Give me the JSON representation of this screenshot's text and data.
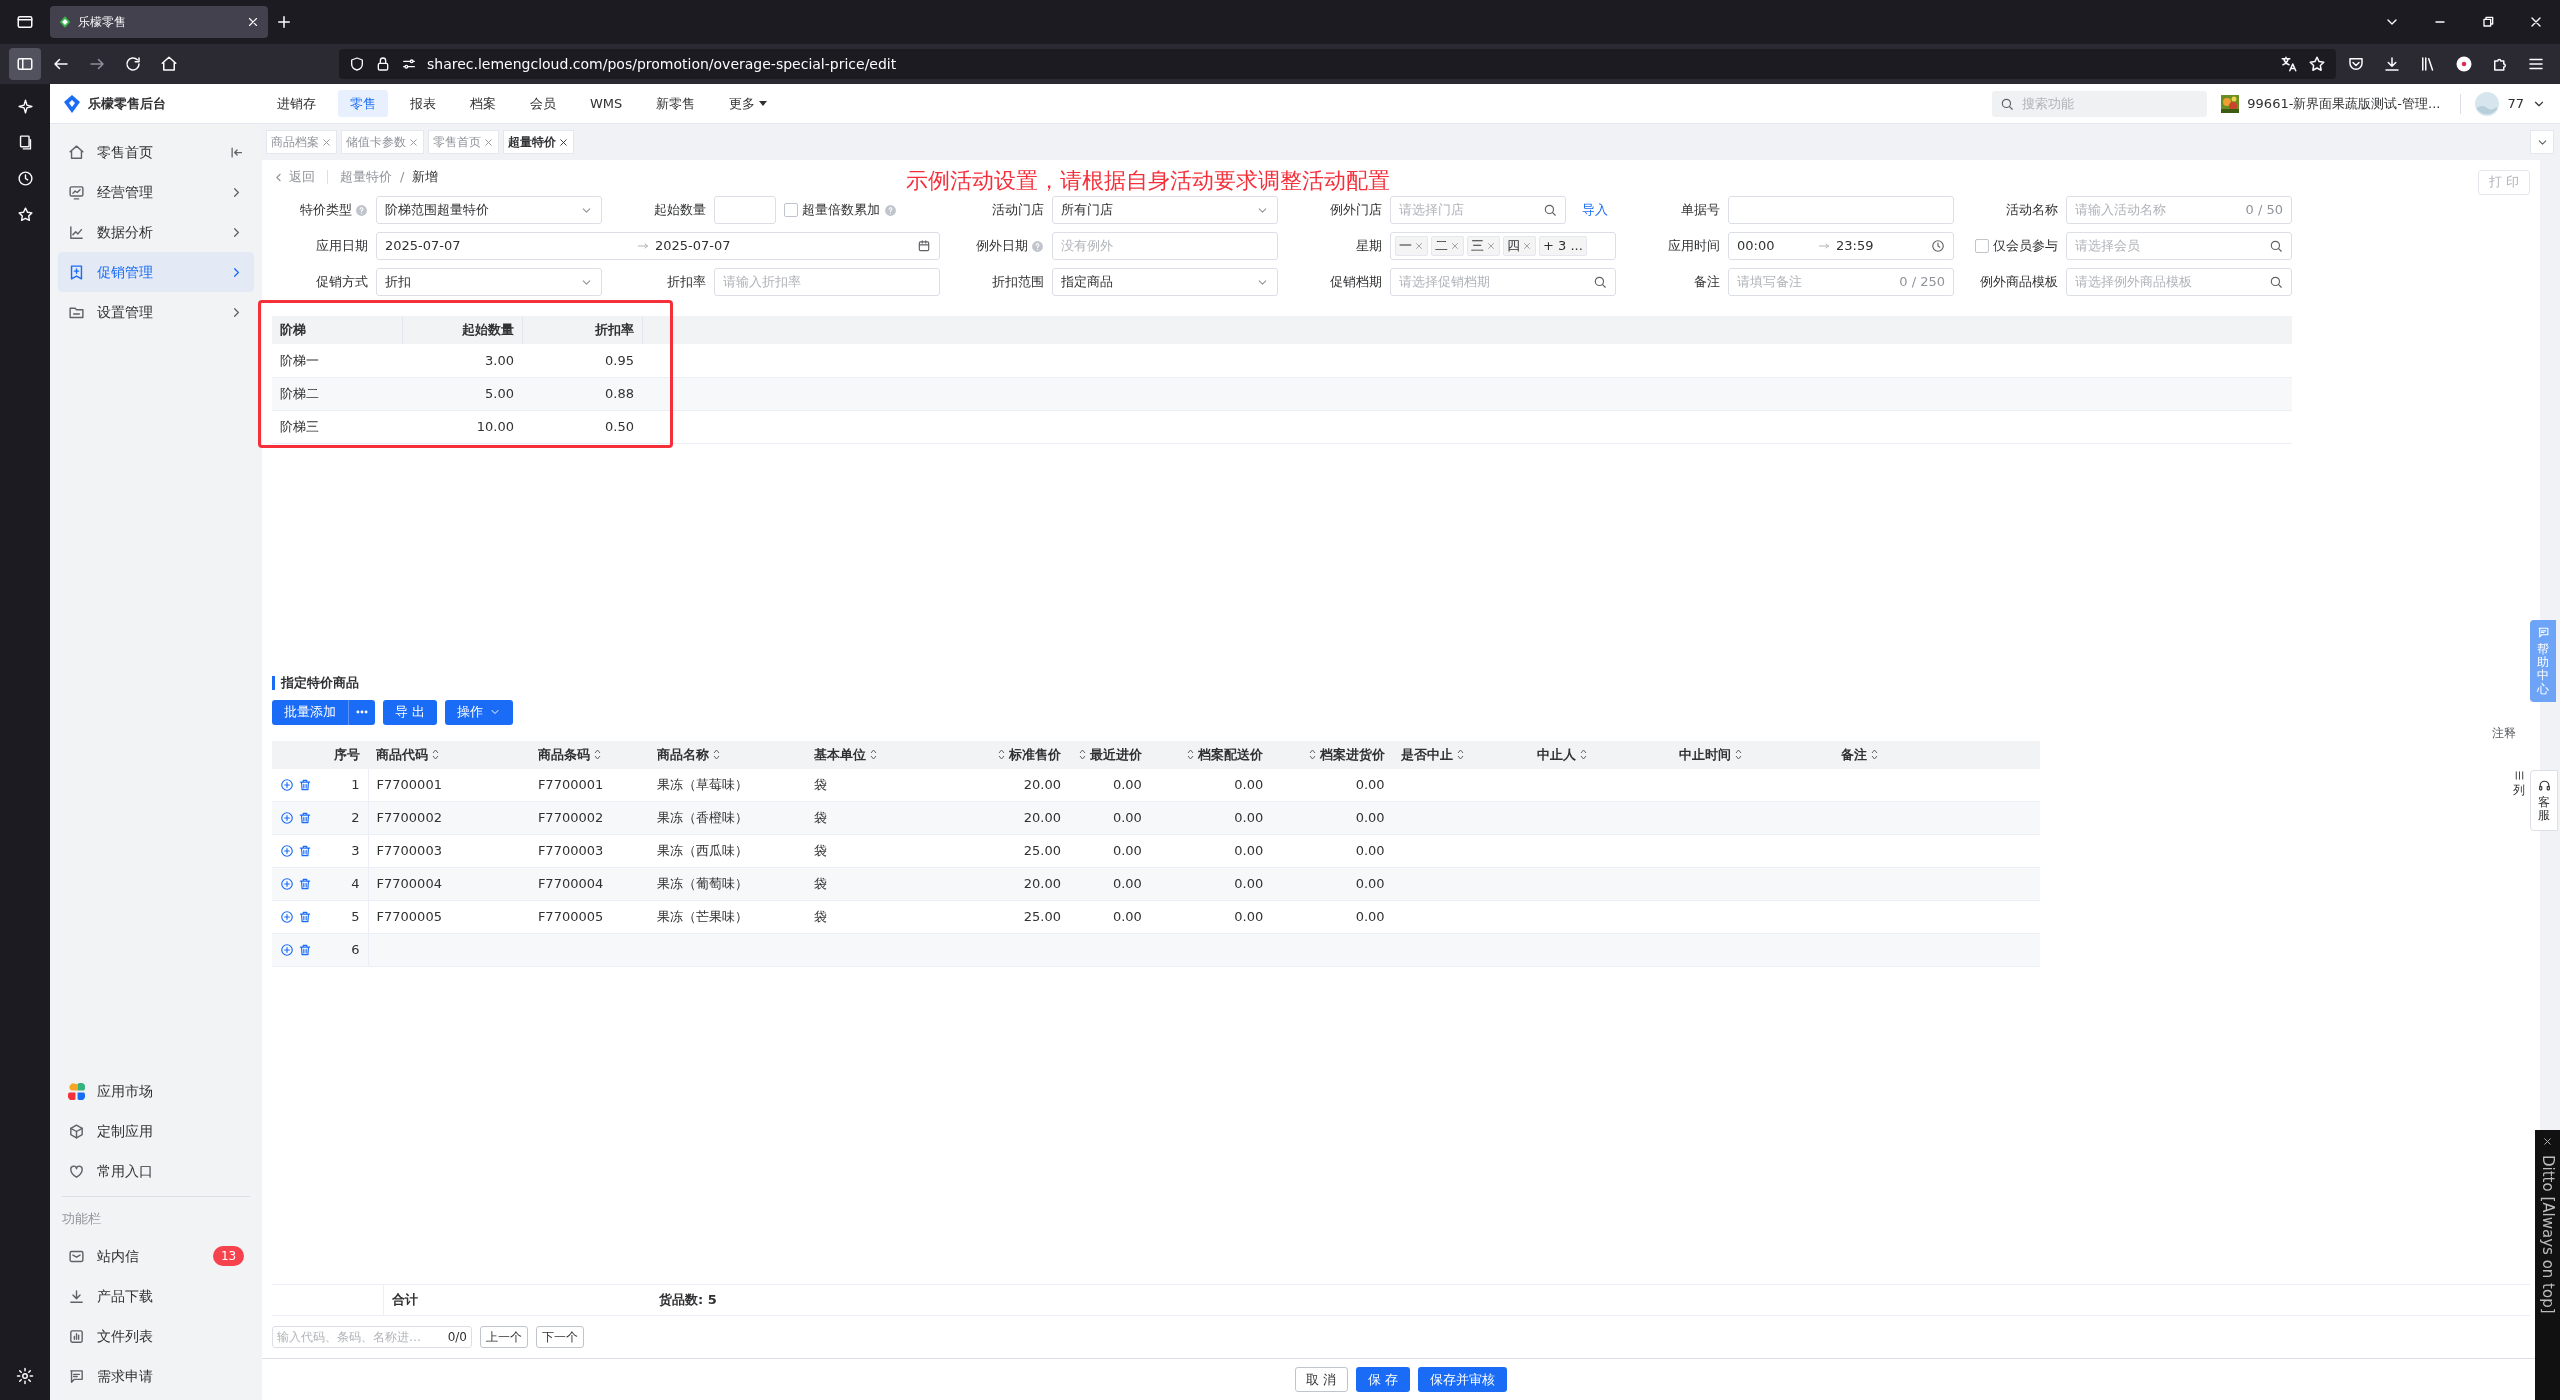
{
  "browser": {
    "tab_title": "乐檬零售",
    "url": "sharec.lemengcloud.com/pos/promotion/overage-special-price/edit"
  },
  "topbar": {
    "logo": "乐檬零售后台",
    "nav": [
      {
        "label": "进销存",
        "selected": false
      },
      {
        "label": "零售",
        "selected": true
      },
      {
        "label": "报表",
        "selected": false
      },
      {
        "label": "档案",
        "selected": false
      },
      {
        "label": "会员",
        "selected": false
      },
      {
        "label": "WMS",
        "selected": false
      },
      {
        "label": "新零售",
        "selected": false
      },
      {
        "label": "更多",
        "selected": false,
        "dropdown": true
      }
    ],
    "search": {
      "placeholder": "搜索功能"
    },
    "store": "99661-新界面果蔬版测试-管理...",
    "user": "77"
  },
  "sidebar": {
    "menu": [
      {
        "label": "零售首页",
        "selected": false,
        "collapse": true
      },
      {
        "label": "经营管理",
        "selected": false
      },
      {
        "label": "数据分析",
        "selected": false
      },
      {
        "label": "促销管理",
        "selected": true
      },
      {
        "label": "设置管理",
        "selected": false
      }
    ],
    "apps": [
      {
        "label": "应用市场"
      },
      {
        "label": "定制应用"
      },
      {
        "label": "常用入口"
      }
    ],
    "section": "功能栏",
    "tools": [
      {
        "label": "站内信",
        "badge": "13"
      },
      {
        "label": "产品下载"
      },
      {
        "label": "文件列表"
      },
      {
        "label": "需求申请"
      }
    ]
  },
  "page_tabs": [
    {
      "label": "商品档案",
      "selected": false
    },
    {
      "label": "储值卡参数",
      "selected": false
    },
    {
      "label": "零售首页",
      "selected": false
    },
    {
      "label": "超量特价",
      "selected": true
    }
  ],
  "breadcrumb": {
    "back": "返回",
    "parent": "超量特价",
    "separator": "/",
    "current": "新增"
  },
  "notice": "示例活动设置，请根据自身活动要求调整活动配置",
  "print_button": {
    "label": "打 印",
    "disabled": true
  },
  "form": [
    {
      "label": "特价类型",
      "help": true,
      "kind": "select",
      "value": "阶梯范围超量特价"
    },
    {
      "label": "起始数量",
      "kind": "short_input",
      "checkbox": {
        "label": "超量倍数累加",
        "checked": false,
        "help": true
      }
    },
    {
      "label": "活动门店",
      "kind": "select",
      "value": "所有门店"
    },
    {
      "label": "例外门店",
      "kind": "search",
      "placeholder": "请选择门店",
      "link": "导入"
    },
    {
      "label": "单据号",
      "kind": "input"
    },
    {
      "label": "活动名称",
      "kind": "input",
      "placeholder": "请输入活动名称",
      "counter": "0 / 50"
    },
    {
      "label": "应用日期",
      "kind": "date_range",
      "start": "2025-07-07",
      "end": "2025-07-07"
    },
    {
      "label": "例外日期",
      "help": true,
      "kind": "input",
      "placeholder": "没有例外"
    },
    {
      "label": "星期",
      "kind": "tags",
      "tags": [
        "一",
        "二",
        "三",
        "四"
      ],
      "more": "+ 3 ..."
    },
    {
      "label": "应用时间",
      "kind": "time_range",
      "start": "00:00",
      "end": "23:59"
    },
    {
      "kind": "checkbox_search",
      "checkbox": {
        "label": "仅会员参与",
        "checked": false
      },
      "placeholder": "请选择会员"
    },
    {
      "label": "促销方式",
      "kind": "select",
      "value": "折扣"
    },
    {
      "label": "折扣率",
      "kind": "input",
      "placeholder": "请输入折扣率"
    },
    {
      "label": "折扣范围",
      "kind": "select",
      "value": "指定商品"
    },
    {
      "label": "促销档期",
      "kind": "search",
      "placeholder": "请选择促销档期"
    },
    {
      "label": "备注",
      "kind": "input",
      "placeholder": "请填写备注",
      "counter": "0 / 250"
    },
    {
      "label": "例外商品模板",
      "kind": "search",
      "placeholder": "请选择例外商品模板"
    }
  ],
  "tiers": {
    "columns": [
      "阶梯",
      "起始数量",
      "折扣率"
    ],
    "rows": [
      [
        "阶梯一",
        "3.00",
        "0.95"
      ],
      [
        "阶梯二",
        "5.00",
        "0.88"
      ],
      [
        "阶梯三",
        "10.00",
        "0.50"
      ]
    ]
  },
  "products": {
    "title": "指定特价商品",
    "add_button": "批量添加",
    "export_button": "导 出",
    "ops_button": "操作",
    "columns": [
      {
        "label": "序号",
        "sortable": false
      },
      {
        "label": "商品代码",
        "sortable": true
      },
      {
        "label": "商品条码",
        "sortable": true
      },
      {
        "label": "商品名称",
        "sortable": true
      },
      {
        "label": "基本单位",
        "sortable": true
      },
      {
        "label": "标准售价",
        "sortable": true
      },
      {
        "label": "最近进价",
        "sortable": true
      },
      {
        "label": "档案配送价",
        "sortable": true
      },
      {
        "label": "档案进货价",
        "sortable": true
      },
      {
        "label": "是否中止",
        "sortable": true
      },
      {
        "label": "中止人",
        "sortable": true
      },
      {
        "label": "中止时间",
        "sortable": true
      },
      {
        "label": "备注",
        "sortable": true
      }
    ],
    "rows": [
      {
        "no": "1",
        "cells": [
          "F7700001",
          "F7700001",
          "果冻（草莓味）",
          "袋",
          "20.00",
          "0.00",
          "0.00",
          "0.00"
        ]
      },
      {
        "no": "2",
        "cells": [
          "F7700002",
          "F7700002",
          "果冻（香橙味）",
          "袋",
          "20.00",
          "0.00",
          "0.00",
          "0.00"
        ]
      },
      {
        "no": "3",
        "cells": [
          "F7700003",
          "F7700003",
          "果冻（西瓜味）",
          "袋",
          "25.00",
          "0.00",
          "0.00",
          "0.00"
        ]
      },
      {
        "no": "4",
        "cells": [
          "F7700004",
          "F7700004",
          "果冻（葡萄味）",
          "袋",
          "20.00",
          "0.00",
          "0.00",
          "0.00"
        ]
      },
      {
        "no": "5",
        "cells": [
          "F7700005",
          "F7700005",
          "果冻（芒果味）",
          "袋",
          "25.00",
          "0.00",
          "0.00",
          "0.00"
        ]
      },
      {
        "no": "6"
      }
    ],
    "summary": {
      "label": "合计",
      "count": "货品数: 5"
    },
    "finder": {
      "placeholder": "输入代码、条码、名称进…",
      "count": "0/0",
      "prev": "上一个",
      "next": "下一个"
    }
  },
  "actions": {
    "cancel": "取 消",
    "save": "保 存",
    "save_audit": "保存并审核"
  },
  "side_widgets": {
    "help": "帮助中心",
    "note": "注释",
    "columns": "列",
    "service": "客服"
  },
  "ditto": {
    "title": "Ditto [Always on top]"
  }
}
